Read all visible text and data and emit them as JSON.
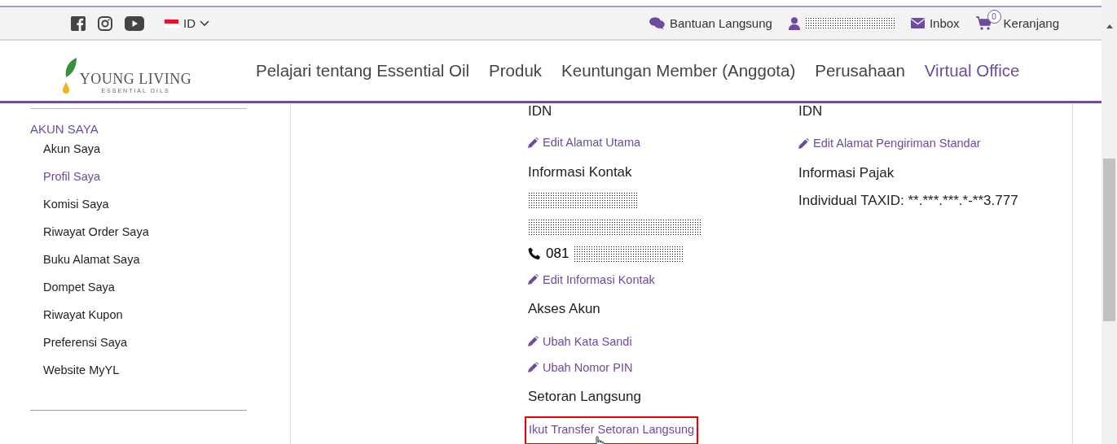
{
  "logo": {
    "name": "YOUNG LIVING",
    "tagline": "ESSENTIAL OILS"
  },
  "top_bar": {
    "language": "ID",
    "utility_links": [
      {
        "kind": "chat",
        "label": "Bantuan Langsung"
      },
      {
        "kind": "user"
      },
      {
        "kind": "mail",
        "label": "Inbox"
      },
      {
        "kind": "cart",
        "label": "Keranjang",
        "badge": "0"
      }
    ]
  },
  "nav": {
    "items": [
      {
        "label": "Pelajari tentang Essential Oil",
        "selected": false
      },
      {
        "label": "Produk",
        "selected": false
      },
      {
        "label": "Keuntungan Member (Anggota)",
        "selected": false
      },
      {
        "label": "Perusahaan",
        "selected": false
      },
      {
        "label": "Virtual Office",
        "selected": true
      }
    ]
  },
  "sidebar": {
    "heading": "AKUN SAYA",
    "items": [
      {
        "label": "Akun Saya",
        "selected": false
      },
      {
        "label": "Profil Saya",
        "selected": true
      },
      {
        "label": "Komisi Saya",
        "selected": false
      },
      {
        "label": "Riwayat Order Saya",
        "selected": false
      },
      {
        "label": "Buku Alamat Saya",
        "selected": false
      },
      {
        "label": "Dompet Saya",
        "selected": false
      },
      {
        "label": "Riwayat Kupon",
        "selected": false
      },
      {
        "label": "Preferensi Saya",
        "selected": false
      },
      {
        "label": "Website MyYL",
        "selected": false
      }
    ]
  },
  "columns": [
    [
      {
        "kind": "text",
        "text": "IDN"
      },
      {
        "kind": "link",
        "text": "Edit Alamat Utama"
      },
      {
        "kind": "heading",
        "text": "Informasi Kontak"
      },
      {
        "kind": "redacted"
      },
      {
        "kind": "redacted"
      },
      {
        "kind": "phone",
        "text": "081"
      },
      {
        "kind": "link",
        "text": "Edit Informasi Kontak"
      },
      {
        "kind": "heading",
        "text": "Akses Akun"
      },
      {
        "kind": "link",
        "text": "Ubah Kata Sandi"
      },
      {
        "kind": "link",
        "text": "Ubah Nomor PIN"
      },
      {
        "kind": "heading",
        "text": "Setoran Langsung"
      },
      {
        "kind": "highlight_link",
        "text": "Ikut Transfer Setoran Langsung"
      }
    ],
    [
      {
        "kind": "text",
        "text": "IDN"
      },
      {
        "kind": "link",
        "text": "Edit Alamat Pengiriman Standar"
      },
      {
        "kind": "heading",
        "text": "Informasi Pajak"
      },
      {
        "kind": "text",
        "text": "Individual TAXID: **.***.***.*-**3.777"
      }
    ]
  ]
}
